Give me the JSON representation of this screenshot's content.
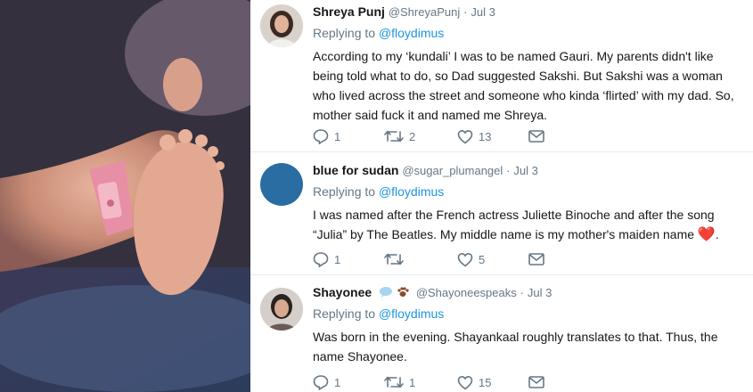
{
  "tweets": [
    {
      "name": "Shreya Punj",
      "handle": "@ShreyaPunj",
      "date": "Jul 3",
      "replying_label": "Replying to",
      "replying_to": "@floydimus",
      "text": "According to my ‘kundali’ I was to be named Gauri. My parents didn't like being told what to do, so Dad suggested Sakshi. But Sakshi was a woman who lived across the street and someone who kinda ‘flirted’ with my dad. So, mother said fuck it and named me Shreya.",
      "replies": "1",
      "retweets": "2",
      "likes": "13"
    },
    {
      "name": "blue for sudan",
      "handle": "@sugar_plumangel",
      "date": "Jul 3",
      "replying_label": "Replying to",
      "replying_to": "@floydimus",
      "text": "I was named after the French actress Juliette Binoche and after the song “Julia” by The Beatles. My middle name is my mother's maiden name",
      "emoji": "❤️",
      "replies": "1",
      "retweets": "",
      "likes": "5"
    },
    {
      "name": "Shayonee",
      "handle": "@Shayoneespeaks",
      "date": "Jul 3",
      "replying_label": "Replying to",
      "replying_to": "@floydimus",
      "text": "Was born in the evening. Shayankaal roughly translates to that. Thus, the name Shayonee.",
      "replies": "1",
      "retweets": "1",
      "likes": "15"
    }
  ],
  "colors": {
    "accent": "#1b95e0",
    "muted": "#657786",
    "text": "#14171a",
    "divider": "#e6ecf0",
    "heart": "#e0245e"
  },
  "icons": [
    "reply-icon",
    "retweet-icon",
    "like-icon",
    "direct-message-icon",
    "speech-bubble-badge-icon",
    "paw-badge-icon"
  ]
}
